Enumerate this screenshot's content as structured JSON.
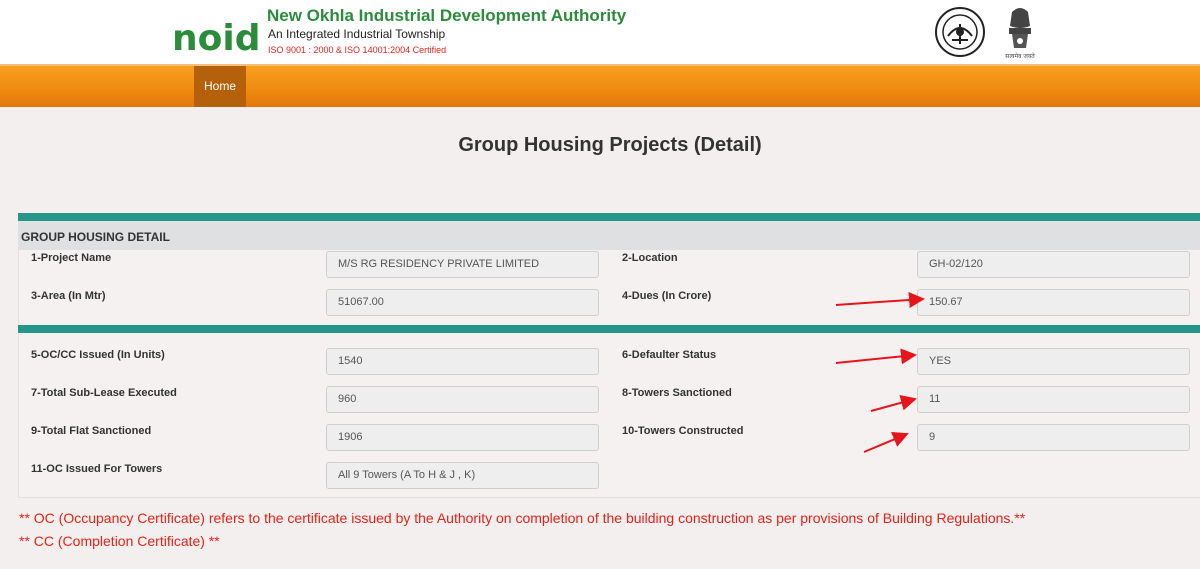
{
  "header": {
    "logo_text": "noida",
    "org_name": "New Okhla Industrial Development Authority",
    "tagline": "An Integrated Industrial Township",
    "iso": "ISO 9001 : 2000 & ISO 14001:2004 Certified",
    "emblem_caption": "सत्यमेव जयते"
  },
  "nav": {
    "home_label": "Home"
  },
  "page": {
    "title": "Group Housing Projects (Detail)"
  },
  "detail": {
    "section_title": "GROUP HOUSING DETAIL",
    "fields": [
      {
        "label": "1-Project Name",
        "value": "M/S RG RESIDENCY PRIVATE LIMITED"
      },
      {
        "label": "2-Location",
        "value": "GH-02/120"
      },
      {
        "label": "3-Area (In Mtr)",
        "value": "51067.00"
      },
      {
        "label": "4-Dues (In Crore)",
        "value": "150.67"
      },
      {
        "label": "5-OC/CC Issued (In Units)",
        "value": "1540"
      },
      {
        "label": "6-Defaulter Status",
        "value": "YES"
      },
      {
        "label": "7-Total Sub-Lease Executed",
        "value": "960"
      },
      {
        "label": "8-Towers Sanctioned",
        "value": "11"
      },
      {
        "label": "9-Total Flat Sanctioned",
        "value": "1906"
      },
      {
        "label": "10-Towers Constructed",
        "value": "9"
      },
      {
        "label": "11-OC Issued For Towers",
        "value": "All 9 Towers (A To H & J , K)"
      }
    ]
  },
  "notes": {
    "oc": "** OC (Occupancy Certificate) refers to the certificate issued by the Authority on completion of the building construction as per provisions of Building Regulations.**",
    "cc": "** CC (Completion Certificate) **"
  },
  "colors": {
    "brand_green": "#2c8c3c",
    "nav_orange": "#ef8a10",
    "nav_active": "#b5600a",
    "section_bar": "#26968a",
    "note_red": "#e2231a",
    "annotation_arrow": "#e8141b"
  }
}
